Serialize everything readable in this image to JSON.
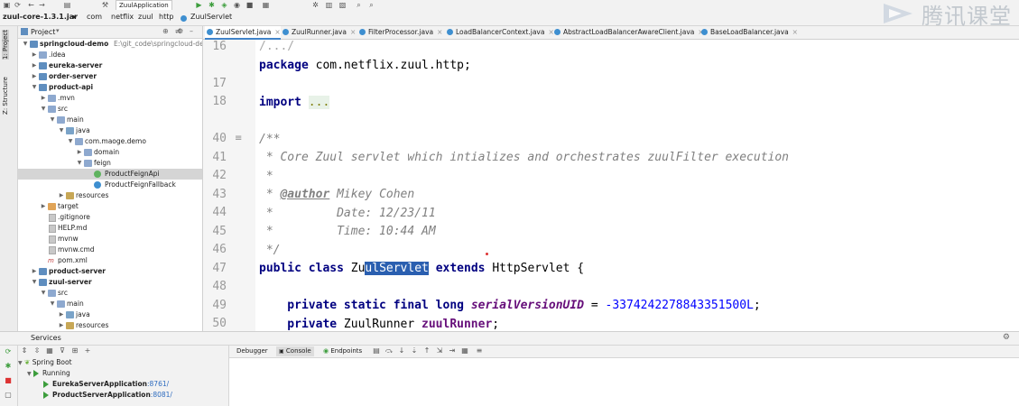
{
  "toolbar": {
    "run_config": "ZuulApplication",
    "icons": [
      "save-icon",
      "sync-icon",
      "undo-icon",
      "redo-icon",
      "build-icon",
      "run-icon",
      "debug-icon",
      "coverage-icon",
      "profile-icon",
      "stop-icon",
      "structure-icon",
      "settings-icon",
      "project-structure-icon",
      "search-icon",
      "search-icon"
    ]
  },
  "breadcrumb": [
    "zuul-core-1.3.1.jar",
    "com",
    "netflix",
    "zuul",
    "http",
    "ZuulServlet"
  ],
  "watermark": {
    "text": "腾讯课堂"
  },
  "left_strip": {
    "tab1": "1: Project",
    "tab2": "Z: Structure"
  },
  "project_panel": {
    "title": "Project",
    "tree": [
      {
        "label": "springcloud-demo",
        "suffix": "E:\\git_code\\springcloud-dem",
        "bold": true
      },
      {
        "label": ".idea",
        "bold": false
      },
      {
        "label": "eureka-server",
        "bold": true
      },
      {
        "label": "order-server",
        "bold": true
      },
      {
        "label": "product-api",
        "bold": true
      },
      {
        "label": ".mvn",
        "bold": false
      },
      {
        "label": "src",
        "bold": false
      },
      {
        "label": "main",
        "bold": false
      },
      {
        "label": "java",
        "bold": false
      },
      {
        "label": "com.maoge.demo",
        "bold": false
      },
      {
        "label": "domain",
        "bold": false
      },
      {
        "label": "feign",
        "bold": false
      },
      {
        "label": "ProductFeignApi",
        "bold": false
      },
      {
        "label": "ProductFeignFallback",
        "bold": false
      },
      {
        "label": "resources",
        "bold": false
      },
      {
        "label": "target",
        "bold": false
      },
      {
        "label": ".gitignore",
        "bold": false
      },
      {
        "label": "HELP.md",
        "bold": false
      },
      {
        "label": "mvnw",
        "bold": false
      },
      {
        "label": "mvnw.cmd",
        "bold": false
      },
      {
        "label": "pom.xml",
        "bold": false
      },
      {
        "label": "product-server",
        "bold": true
      },
      {
        "label": "zuul-server",
        "bold": true
      },
      {
        "label": "src",
        "bold": false
      },
      {
        "label": "main",
        "bold": false
      },
      {
        "label": "java",
        "bold": false
      },
      {
        "label": "resources",
        "bold": false
      }
    ]
  },
  "editor_tabs": [
    "ZuulServlet.java",
    "ZuulRunner.java",
    "FilterProcessor.java",
    "LoadBalancerContext.java",
    "AbstractLoadBalancerAwareClient.java",
    "BaseLoadBalancer.java"
  ],
  "editor": {
    "line_numbers": [
      "16",
      "17",
      "18",
      "40",
      "41",
      "42",
      "43",
      "44",
      "45",
      "46",
      "47",
      "48",
      "49",
      "50"
    ],
    "l1": "/.../",
    "l2_kw": "package",
    "l2_rest": " com.netflix.zuul.http;",
    "l4_kw": "import",
    "l4_rest": "...",
    "l6": "/**",
    "l7": " * Core Zuul servlet which intializes and orchestrates zuulFilter execution",
    "l8": " *",
    "l9_pre": " * ",
    "l9_tag": "@author",
    "l9_rest": " Mikey Cohen",
    "l10": " *         Date: 12/23/11",
    "l11": " *         Time: 10:44 AM",
    "l12": " */",
    "l13_kw1": "public",
    "l13_kw2": "class",
    "l13_a": "Zu",
    "l13_sel": "ulServlet",
    "l13_kw3": "extends",
    "l13_rest": " HttpServlet {",
    "l15_kw": "    private static final long",
    "l15_const": "serialVersionUID",
    "l15_eq": " = ",
    "l15_num": "-3374242278843351500L",
    "l15_end": ";",
    "l16_kw": "    private",
    "l16_type": " ZuulRunner ",
    "l16_field": "zuulRunner",
    "l16_end": ";"
  },
  "services": {
    "title": "Services",
    "tabs": [
      "Debugger",
      "Console",
      "Endpoints"
    ],
    "tree": {
      "root": "Spring Boot",
      "group": "Running",
      "apps": [
        {
          "name": "EurekaServerApplication",
          "port": ":8761/"
        },
        {
          "name": "ProductServerApplication",
          "port": ":8081/"
        }
      ]
    }
  }
}
